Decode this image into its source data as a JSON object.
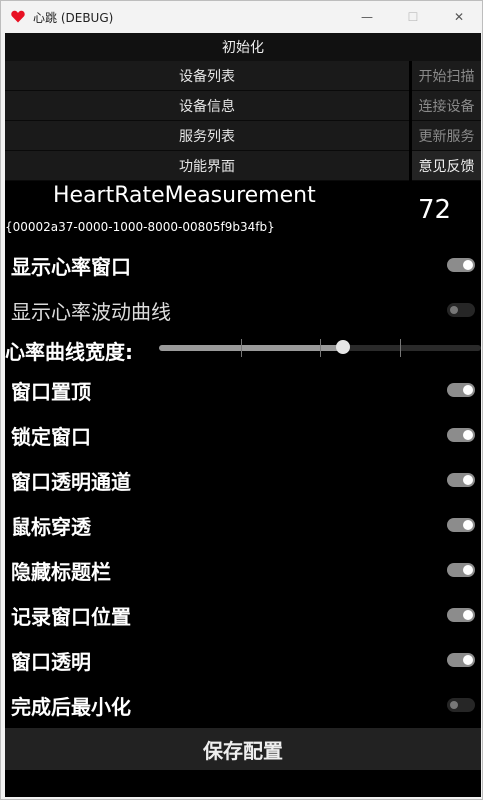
{
  "window": {
    "title": "心跳 (DEBUG)",
    "icon": "heart-icon",
    "controls": {
      "minimize": "—",
      "maximize": "☐",
      "close": "✕"
    }
  },
  "menu": {
    "init": "初始化",
    "left": [
      "设备列表",
      "设备信息",
      "服务列表",
      "功能界面"
    ],
    "right": [
      "开始扫描",
      "连接设备",
      "更新服务",
      "意见反馈"
    ]
  },
  "measurement": {
    "name": "HeartRateMeasurement",
    "value": "72",
    "uuid": "{00002a37-0000-1000-8000-00805f9b34fb}"
  },
  "settings": {
    "show_window": {
      "label": "显示心率窗口",
      "on": true
    },
    "show_curve": {
      "label": "显示心率波动曲线",
      "on": false
    },
    "curve_width": {
      "label": "心率曲线宽度:",
      "value_fraction": 0.57
    },
    "on_top": {
      "label": "窗口置顶",
      "on": true
    },
    "lock": {
      "label": "锁定窗口",
      "on": true
    },
    "transparent_channel": {
      "label": "窗口透明通道",
      "on": true
    },
    "mouse_through": {
      "label": "鼠标穿透",
      "on": true
    },
    "hide_titlebar": {
      "label": "隐藏标题栏",
      "on": true
    },
    "remember_position": {
      "label": "记录窗口位置",
      "on": true
    },
    "transparent": {
      "label": "窗口透明",
      "on": true
    },
    "minimize_after": {
      "label": "完成后最小化",
      "on": false
    }
  },
  "save": "保存配置"
}
